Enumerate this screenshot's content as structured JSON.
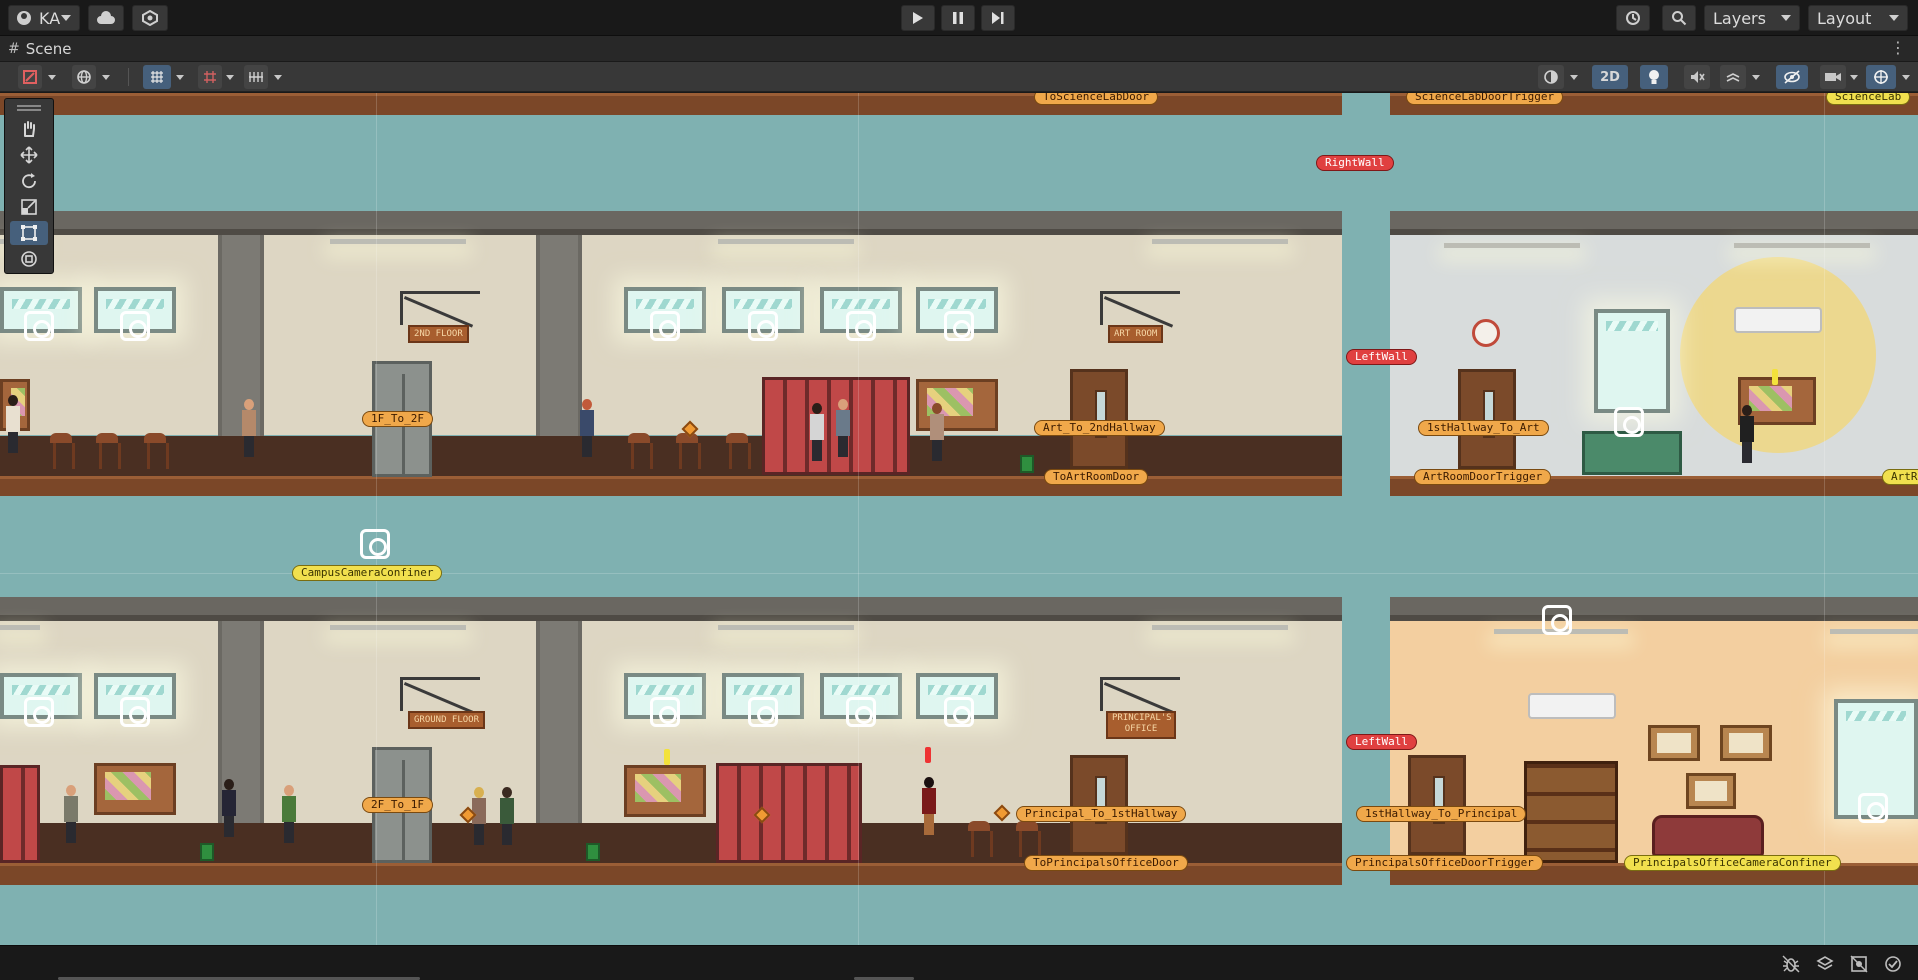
{
  "topbar": {
    "account": {
      "label": "KA",
      "icon": "account-icon"
    },
    "cloud_icon": "cloud-icon",
    "collab_icon": "collab-icon",
    "play_icon": "play-icon",
    "pause_icon": "pause-icon",
    "step_icon": "step-icon",
    "history_icon": "history-icon",
    "search_icon": "search-icon",
    "layers_label": "Layers",
    "layout_label": "Layout"
  },
  "tab": {
    "label": "Scene",
    "icon": "hash-icon"
  },
  "scenebar": {
    "toggle_2d_label": "2D",
    "active_color": "#46607c"
  },
  "scene_labels": {
    "science_lab_door": "ToScienceLabDoor",
    "science_lab_trigger": "ScienceLabDoorTrigger",
    "science_lab_right": "ScienceLab",
    "right_wall": "RightWall",
    "left_wall_top": "LeftWall",
    "left_wall_bottom": "LeftWall",
    "f1_to_2f": "1F_To_2F",
    "art_to_2nd": "Art_To_2ndHallway",
    "to_art_room_door": "ToArtRoomDoor",
    "hallway_to_art": "1stHallway_To_Art",
    "art_room_trigger": "ArtRoomDoorTrigger",
    "art_right": "ArtR",
    "campus_confiner": "CampusCameraConfiner",
    "f2_to_1f": "2F_To_1F",
    "principal_to_hallway": "Principal_To_1stHallway",
    "to_principals_door": "ToPrincipalsOfficeDoor",
    "hallway_to_principal": "1stHallway_To_Principal",
    "principals_trigger": "PrincipalsOfficeDoorTrigger",
    "principals_confiner": "PrincipalsOfficeCameraConfiner"
  },
  "signs": {
    "second_floor": "2ND FLOOR",
    "art_room": "ART ROOM",
    "ground_floor": "GROUND FLOOR",
    "principals_office": "PRINCIPAL'S OFFICE"
  },
  "colors": {
    "sky": "#7fb1b1",
    "label_orange": "#f0a84a",
    "label_yellow": "#f1e04e",
    "label_red": "#e04040"
  }
}
